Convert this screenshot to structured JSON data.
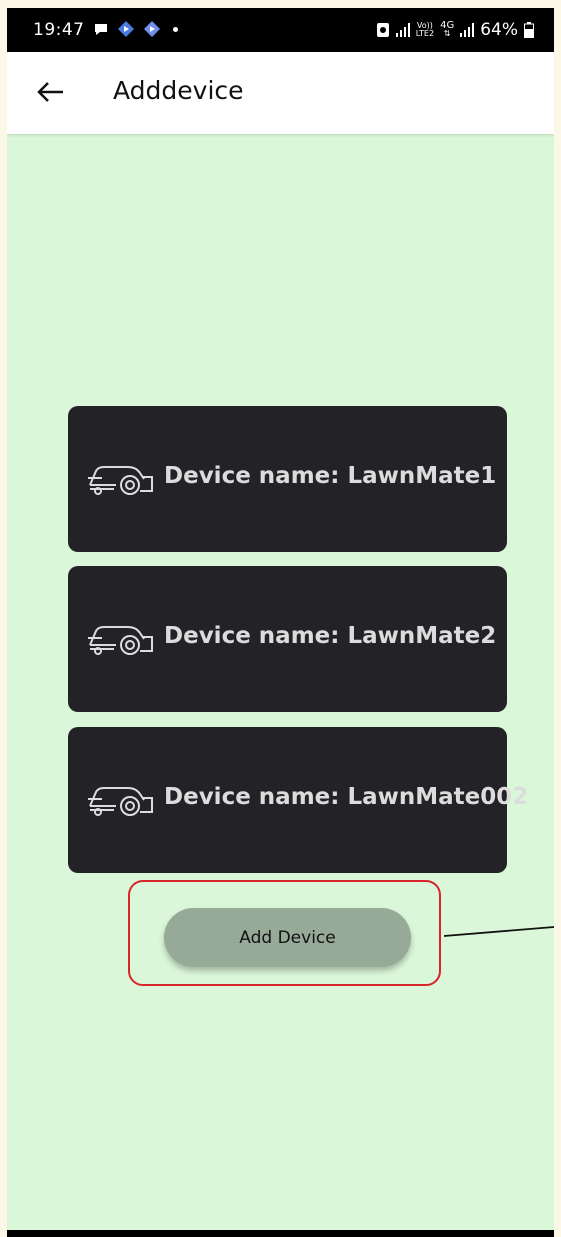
{
  "status_bar": {
    "time": "19:47",
    "carrier_tag_top": "Vo))",
    "carrier_tag_bottom": "LTE2",
    "network": "4G",
    "battery": "64%"
  },
  "app_bar": {
    "title": "Adddevice",
    "back_icon": "arrow-left-icon"
  },
  "devices": [
    {
      "label": "Device name: LawnMate1",
      "icon": "lawnmower-icon"
    },
    {
      "label": "Device name: LawnMate2",
      "icon": "lawnmower-icon"
    },
    {
      "label": "Device name: LawnMate002",
      "icon": "lawnmower-icon"
    }
  ],
  "add_button": {
    "label": "Add Device"
  },
  "colors": {
    "background": "#dbf7d9",
    "card": "#232227",
    "button": "#97a997",
    "highlight": "#d9252a"
  }
}
